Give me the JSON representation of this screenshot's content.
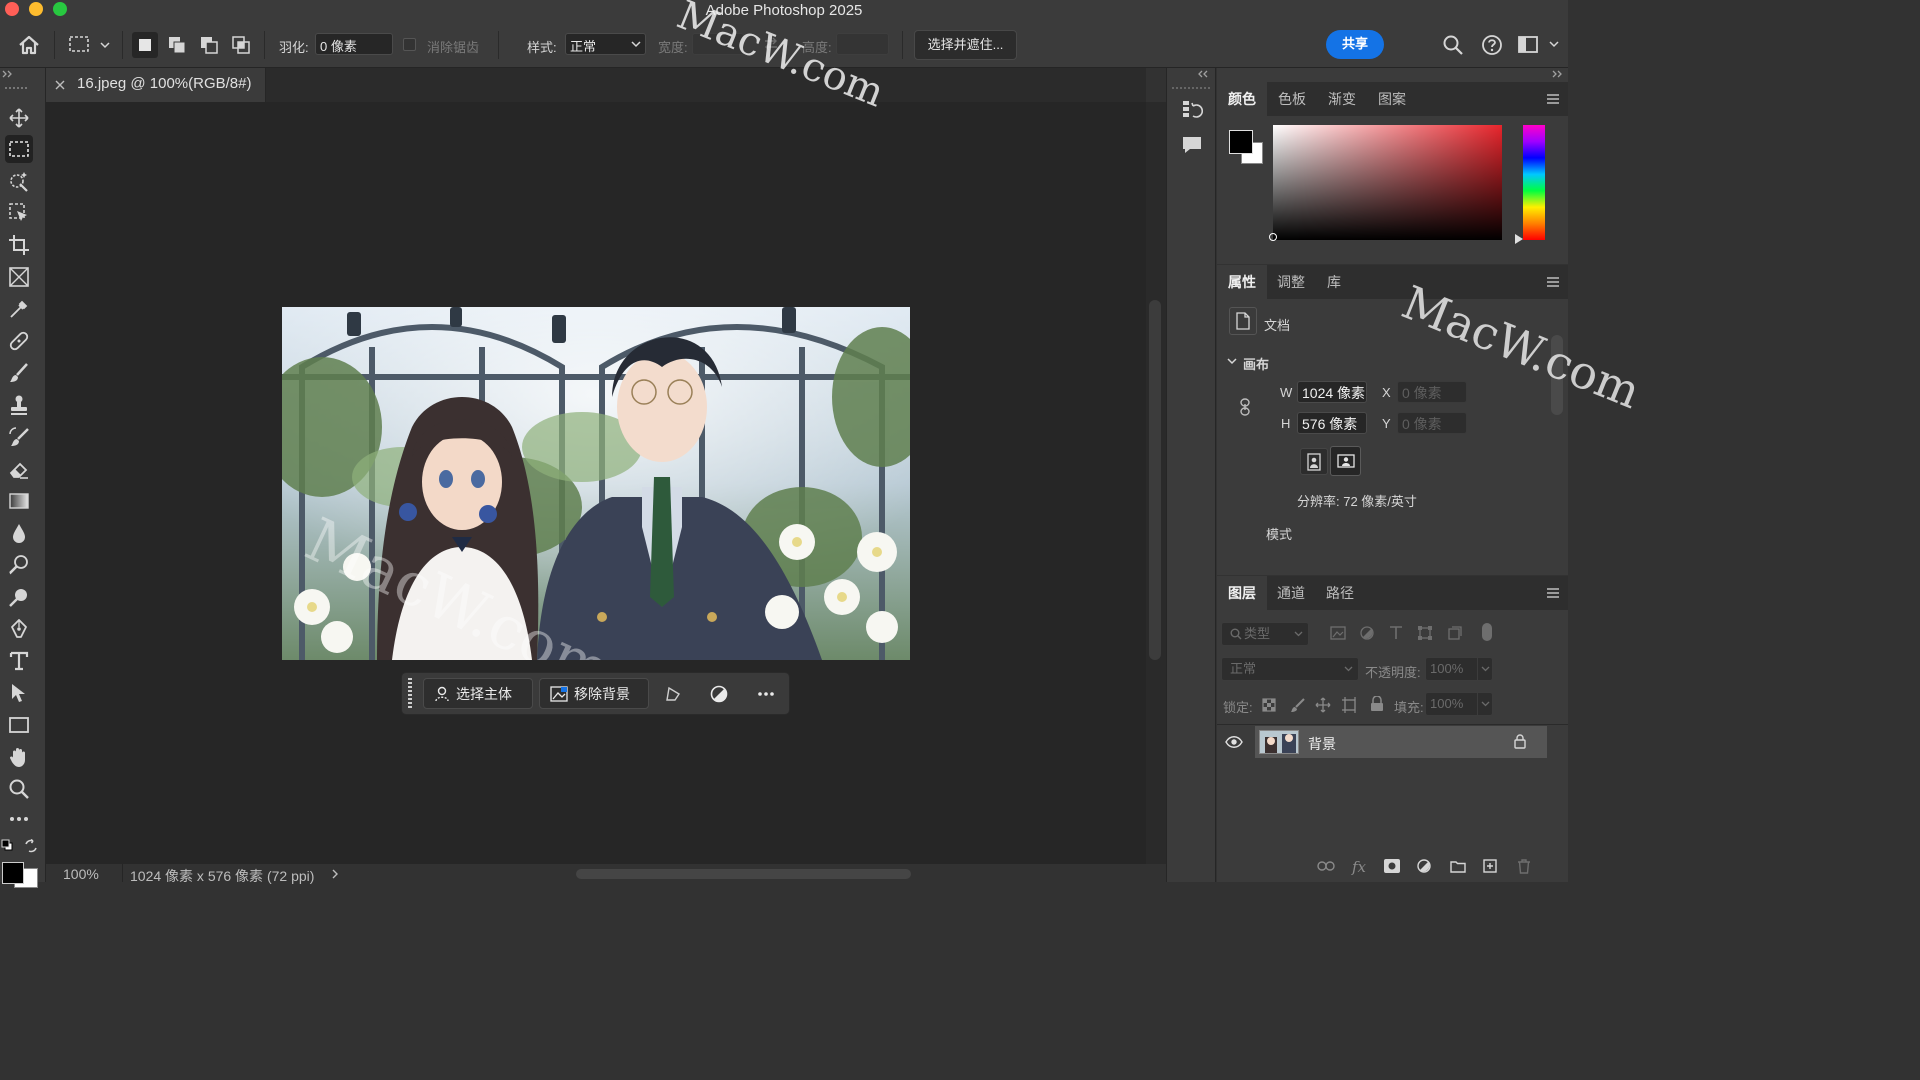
{
  "app": {
    "title": "Adobe Photoshop 2025",
    "watermark_text": "MacW.com"
  },
  "options_bar": {
    "feather_label": "羽化:",
    "feather_value": "0 像素",
    "antialias_label": "消除锯齿",
    "style_label": "样式:",
    "style_value": "正常",
    "width_label": "宽度:",
    "height_label": "高度:",
    "select_mask_button": "选择并遮住...",
    "share_button": "共享"
  },
  "document": {
    "tab_label": "16.jpeg @ 100%(RGB/8#)",
    "zoom": "100%",
    "doc_info": "1024 像素 x 576 像素 (72 ppi)"
  },
  "contextual_taskbar": {
    "select_subject": "选择主体",
    "remove_background": "移除背景"
  },
  "color_panel": {
    "tabs": [
      "颜色",
      "色板",
      "渐变",
      "图案"
    ],
    "active_tab": "颜色",
    "foreground_color": "#000000",
    "background_color": "#ffffff",
    "hue_color": "#e8252c"
  },
  "properties_panel": {
    "tabs": [
      "属性",
      "调整",
      "库"
    ],
    "active_tab": "属性",
    "doc_label": "文档",
    "canvas_section": "画布",
    "w_label": "W",
    "w_value": "1024 像素",
    "h_label": "H",
    "h_value": "576 像素",
    "x_label": "X",
    "x_placeholder": "0 像素",
    "y_label": "Y",
    "y_placeholder": "0 像素",
    "resolution": "分辨率: 72 像素/英寸",
    "mode_label": "模式"
  },
  "layers_panel": {
    "tabs": [
      "图层",
      "通道",
      "路径"
    ],
    "active_tab": "图层",
    "filter_placeholder": "类型",
    "blend_mode": "正常",
    "opacity_label": "不透明度:",
    "opacity_value": "100%",
    "lock_label": "锁定:",
    "fill_label": "填充:",
    "fill_value": "100%",
    "layers": [
      {
        "name": "背景",
        "visible": true,
        "locked": true
      }
    ]
  }
}
